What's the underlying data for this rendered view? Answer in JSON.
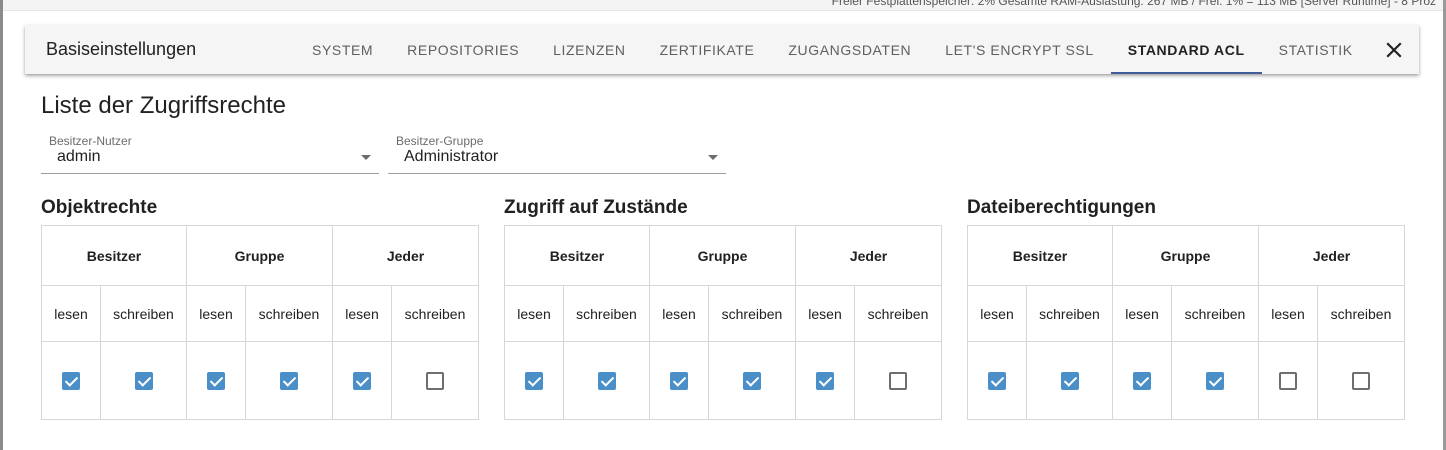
{
  "background": {
    "status_text": "Freier Festplattenspeicher: 2% Gesamte RAM-Auslastung: 267 MB / Frei: 1% = 113 MB [Server Runtime] - 8 Proz"
  },
  "dialog": {
    "title": "Basiseinstellungen",
    "tabs": [
      {
        "label": "SYSTEM",
        "active": false
      },
      {
        "label": "REPOSITORIES",
        "active": false
      },
      {
        "label": "LIZENZEN",
        "active": false
      },
      {
        "label": "ZERTIFIKATE",
        "active": false
      },
      {
        "label": "ZUGANGSDATEN",
        "active": false
      },
      {
        "label": "LET'S ENCRYPT SSL",
        "active": false
      },
      {
        "label": "STANDARD ACL",
        "active": true
      },
      {
        "label": "STATISTIK",
        "active": false
      }
    ],
    "close_icon": "close-icon"
  },
  "page": {
    "title": "Liste der Zugriffsrechte"
  },
  "owner_user": {
    "label": "Besitzer-Nutzer",
    "value": "admin"
  },
  "owner_group": {
    "label": "Besitzer-Gruppe",
    "value": "Administrator"
  },
  "sections": [
    {
      "title": "Objektrechte",
      "groups": [
        "Besitzer",
        "Gruppe",
        "Jeder"
      ],
      "perms": [
        "lesen",
        "schreiben",
        "lesen",
        "schreiben",
        "lesen",
        "schreiben"
      ],
      "checked": [
        true,
        true,
        true,
        true,
        true,
        false
      ]
    },
    {
      "title": "Zugriff auf Zustände",
      "groups": [
        "Besitzer",
        "Gruppe",
        "Jeder"
      ],
      "perms": [
        "lesen",
        "schreiben",
        "lesen",
        "schreiben",
        "lesen",
        "schreiben"
      ],
      "checked": [
        true,
        true,
        true,
        true,
        true,
        false
      ]
    },
    {
      "title": "Dateiberechtigungen",
      "groups": [
        "Besitzer",
        "Gruppe",
        "Jeder"
      ],
      "perms": [
        "lesen",
        "schreiben",
        "lesen",
        "schreiben",
        "lesen",
        "schreiben"
      ],
      "checked": [
        true,
        true,
        true,
        true,
        false,
        false
      ]
    }
  ],
  "colors": {
    "accent": "#3f5b9a",
    "checkbox_checked": "#4a8fc7",
    "appbar_bg": "#f5f5f5"
  }
}
